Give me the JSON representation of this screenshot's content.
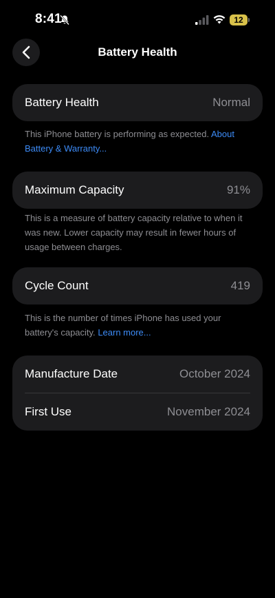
{
  "status_bar": {
    "time": "8:41",
    "battery_level": "12",
    "icons": [
      "bell-slash-icon",
      "cellular-signal-icon",
      "wifi-icon",
      "battery-icon"
    ]
  },
  "nav": {
    "title": "Battery Health",
    "back_icon": "chevron-left-icon"
  },
  "battery_health": {
    "label": "Battery Health",
    "value": "Normal",
    "note": "This iPhone battery is performing as expected.",
    "link": "About Battery & Warranty..."
  },
  "maximum_capacity": {
    "label": "Maximum Capacity",
    "value": "91%",
    "note": "This is a measure of battery capacity relative to when it was new. Lower capacity may result in fewer hours of usage between charges."
  },
  "cycle_count": {
    "label": "Cycle Count",
    "value": "419",
    "note": "This is the number of times iPhone has used your battery's capacity.",
    "link": "Learn more..."
  },
  "dates": {
    "manufacture_label": "Manufacture Date",
    "manufacture_value": "October 2024",
    "first_use_label": "First Use",
    "first_use_value": "November 2024"
  },
  "colors": {
    "background": "#000000",
    "card": "#1c1c1e",
    "secondary_text": "#8e8e93",
    "link": "#3d8bf6",
    "battery_indicator": "#d8c14a"
  }
}
